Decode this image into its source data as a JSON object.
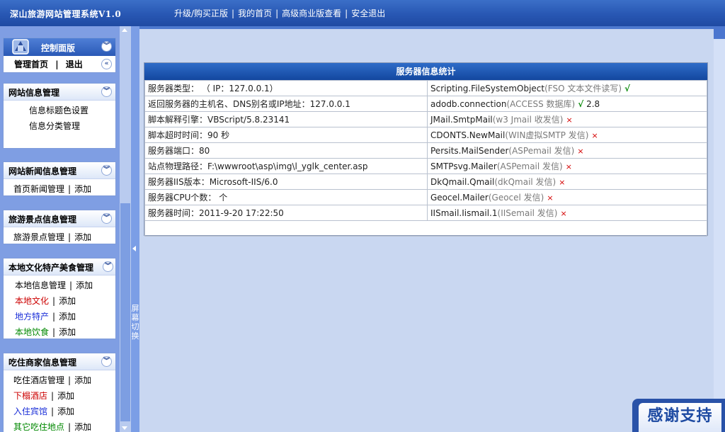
{
  "app": {
    "title": "深山旅游网站管理系统V1.0"
  },
  "topnav": [
    "升级/购买正版",
    "我的首页",
    "高级商业版查看",
    "安全退出"
  ],
  "control_panel": {
    "title": "控制面版",
    "home": "管理首页",
    "logout": "退出"
  },
  "sidebar": {
    "panels": [
      {
        "title": "网站信息管理",
        "items": [
          {
            "label": "信息标题色设置"
          },
          {
            "label": "信息分类管理"
          }
        ]
      },
      {
        "title": "网站新闻信息管理",
        "items": [
          {
            "label": "首页新闻管理",
            "add": "添加"
          }
        ]
      },
      {
        "title": "旅游景点信息管理",
        "items": [
          {
            "label": "旅游景点管理",
            "add": "添加"
          }
        ]
      },
      {
        "title": "本地文化特产美食管理",
        "items": [
          {
            "label": "本地信息管理",
            "add": "添加"
          },
          {
            "label": "本地文化",
            "add": "添加"
          },
          {
            "label": "地方特产",
            "add": "添加"
          },
          {
            "label": "本地饮食",
            "add": "添加"
          }
        ]
      },
      {
        "title": "吃住商家信息管理",
        "items": [
          {
            "label": "吃住酒店管理",
            "add": "添加"
          },
          {
            "label": "下榻酒店",
            "add": "添加"
          },
          {
            "label": "入住宾馆",
            "add": "添加"
          },
          {
            "label": "其它吃住地点",
            "add": "添加"
          }
        ]
      }
    ],
    "colors": {
      "red": "#cc0000",
      "blue": "#1a2ed8",
      "green": "#008800",
      "black": "#000000"
    }
  },
  "splitter": {
    "label": "屏幕切换"
  },
  "info_table": {
    "title": "服务器信息统计",
    "rows": [
      {
        "left": "服务器类型： （ IP：127.0.0.1）",
        "comp": "Scripting.FileSystemObject",
        "desc": "(FSO 文本文件读写)",
        "status": "√",
        "extra": ""
      },
      {
        "left": "返回服务器的主机名、DNS别名或IP地址：127.0.0.1",
        "comp": "adodb.connection",
        "desc": "(ACCESS 数据库)",
        "status": "√",
        "extra": " 2.8"
      },
      {
        "left": "脚本解释引擎：VBScript/5.8.23141",
        "comp": "JMail.SmtpMail",
        "desc": "(w3 Jmail 收发信)",
        "status": "×",
        "extra": ""
      },
      {
        "left": "脚本超时时间：90 秒",
        "comp": "CDONTS.NewMail",
        "desc": "(WIN虚拟SMTP 发信)",
        "status": "×",
        "extra": ""
      },
      {
        "left": "服务器端口：80",
        "comp": "Persits.MailSender",
        "desc": "(ASPemail 发信)",
        "status": "×",
        "extra": ""
      },
      {
        "left": "站点物理路径：F:\\wwwroot\\asp\\img\\l_yglk_center.asp",
        "comp": "SMTPsvg.Mailer",
        "desc": "(ASPemail 发信)",
        "status": "×",
        "extra": ""
      },
      {
        "left": "服务器IIS版本：Microsoft-IIS/6.0",
        "comp": "DkQmail.Qmail",
        "desc": "(dkQmail 发信)",
        "status": "×",
        "extra": ""
      },
      {
        "left": "服务器CPU个数： 个",
        "comp": "Geocel.Mailer",
        "desc": "(Geocel 发信)",
        "status": "×",
        "extra": ""
      },
      {
        "left": "服务器时间：2011-9-20 17:22:50",
        "comp": "IISmail.Iismail.1",
        "desc": "(IISemail 发信)",
        "status": "×",
        "extra": ""
      }
    ]
  },
  "badge": {
    "label": "感谢支持"
  }
}
